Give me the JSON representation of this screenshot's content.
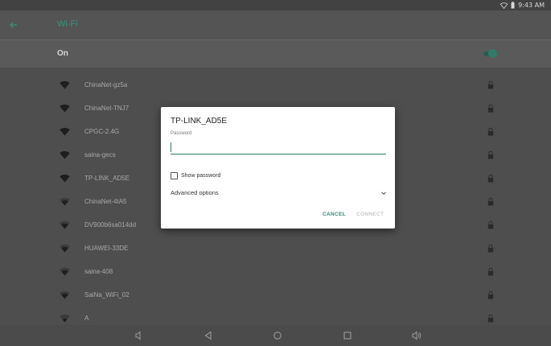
{
  "status_bar": {
    "time": "9:43 AM",
    "icons": [
      "wifi-status-icon",
      "battery-icon"
    ]
  },
  "app_bar": {
    "title": "Wi-Fi"
  },
  "toggle_row": {
    "label": "On",
    "enabled": true
  },
  "networks": [
    {
      "name": "ChinaNet-gz5a",
      "secured": true
    },
    {
      "name": "ChinaNet-TNJ7",
      "secured": true
    },
    {
      "name": "CPGC-2.4G",
      "secured": true
    },
    {
      "name": "saina-gecs",
      "secured": true
    },
    {
      "name": "TP-LINK_AD5E",
      "secured": true
    },
    {
      "name": "ChinaNet-4tA5",
      "secured": true
    },
    {
      "name": "DV900b6sa014dd",
      "secured": true
    },
    {
      "name": "HUAWEI-33DE",
      "secured": true
    },
    {
      "name": "saina-408",
      "secured": true
    },
    {
      "name": "SaiNa_WiFi_02",
      "secured": true
    },
    {
      "name": "A",
      "secured": true
    }
  ],
  "dialog": {
    "title": "TP-LINK_AD5E",
    "password_label": "Password",
    "password_value": "",
    "show_password_label": "Show password",
    "show_password_checked": false,
    "advanced_options_label": "Advanced options",
    "cancel_label": "CANCEL",
    "connect_label": "CONNECT"
  },
  "nav_bar": {
    "buttons": [
      "volume-down-icon",
      "back-triangle-icon",
      "home-circle-icon",
      "recents-square-icon",
      "volume-up-icon"
    ]
  },
  "colors": {
    "accent": "#2f7a68",
    "scrim_bg": "#4e4e4e",
    "dialog_bg": "#ffffff"
  }
}
